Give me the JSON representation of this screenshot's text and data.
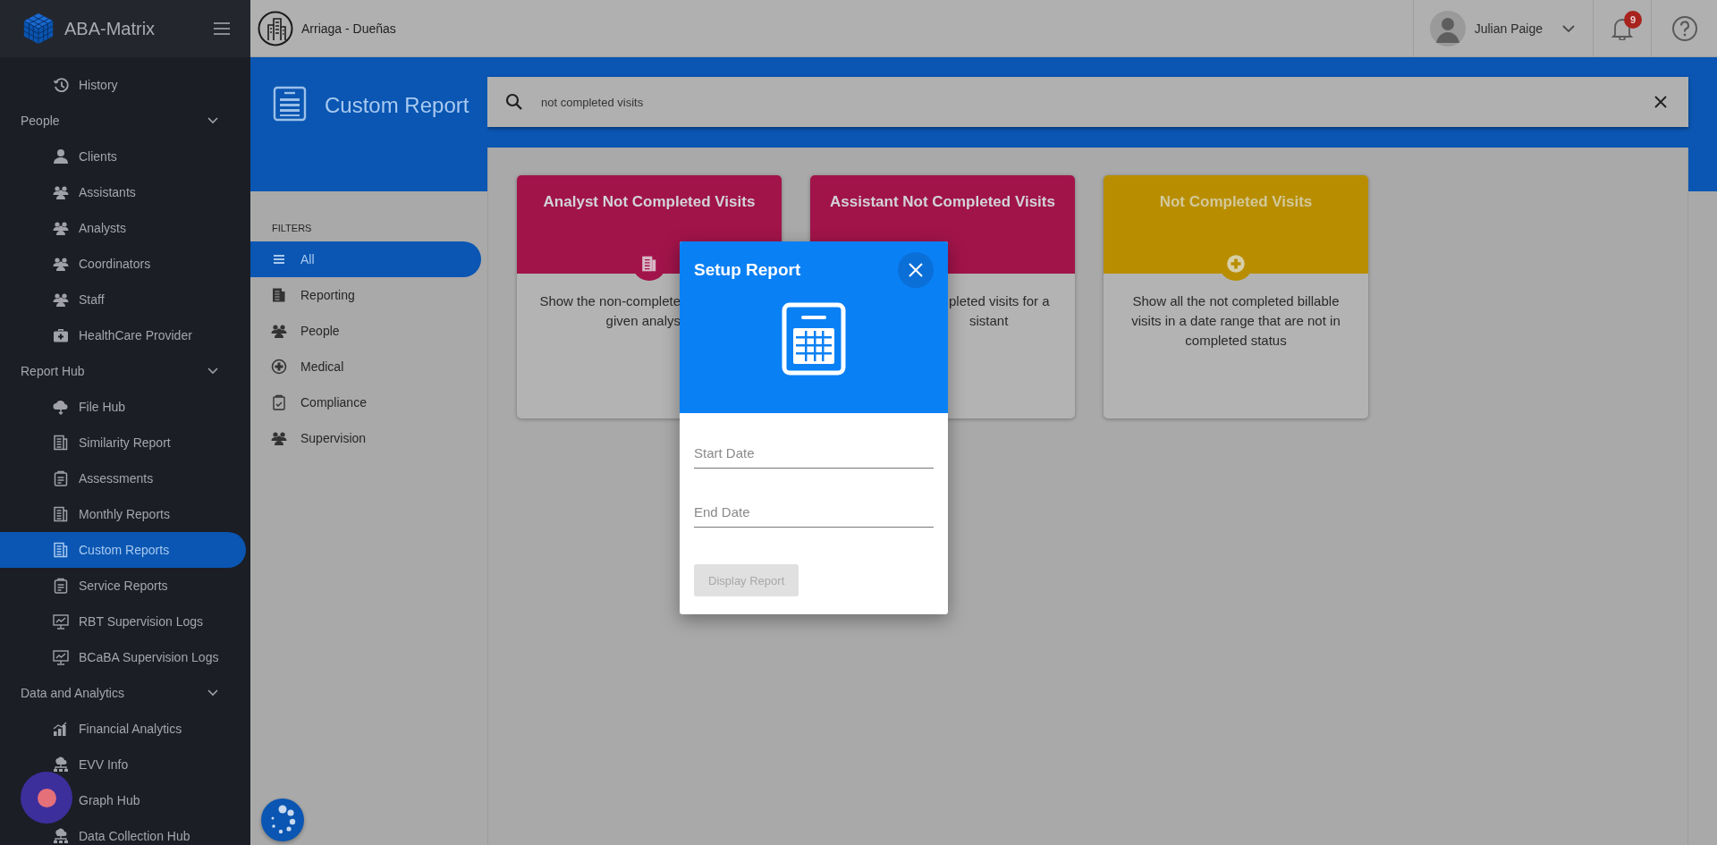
{
  "app": {
    "name": "ABA-Matrix"
  },
  "org": {
    "name": "Arriaga - Dueñas"
  },
  "user": {
    "name": "Julian Paige"
  },
  "notifications": {
    "count": "9"
  },
  "sidebar": {
    "groups": [
      {
        "items": [
          {
            "label": "History",
            "selected": false
          }
        ]
      },
      {
        "title": "People",
        "expanded": true,
        "items": [
          {
            "label": "Clients",
            "selected": false
          },
          {
            "label": "Assistants",
            "selected": false
          },
          {
            "label": "Analysts",
            "selected": false
          },
          {
            "label": "Coordinators",
            "selected": false
          },
          {
            "label": "Staff",
            "selected": false
          },
          {
            "label": "HealthCare Provider",
            "selected": false
          }
        ]
      },
      {
        "title": "Report Hub",
        "expanded": true,
        "items": [
          {
            "label": "File Hub",
            "selected": false
          },
          {
            "label": "Similarity Report",
            "selected": false
          },
          {
            "label": "Assessments",
            "selected": false
          },
          {
            "label": "Monthly Reports",
            "selected": false
          },
          {
            "label": "Custom Reports",
            "selected": true
          },
          {
            "label": "Service Reports",
            "selected": false
          },
          {
            "label": "RBT Supervision Logs",
            "selected": false
          },
          {
            "label": "BCaBA Supervision Logs",
            "selected": false
          }
        ]
      },
      {
        "title": "Data and Analytics",
        "expanded": true,
        "items": [
          {
            "label": "Financial Analytics",
            "selected": false
          },
          {
            "label": "EVV Info",
            "selected": false
          },
          {
            "label": "Graph Hub",
            "selected": false
          },
          {
            "label": "Data Collection Hub",
            "selected": false
          }
        ]
      }
    ]
  },
  "page": {
    "title": "Custom Report"
  },
  "search": {
    "value": "not completed visits"
  },
  "filters": {
    "heading": "FILTERS",
    "items": [
      {
        "label": "All",
        "selected": true
      },
      {
        "label": "Reporting",
        "selected": false
      },
      {
        "label": "People",
        "selected": false
      },
      {
        "label": "Medical",
        "selected": false
      },
      {
        "label": "Compliance",
        "selected": false
      },
      {
        "label": "Supervision",
        "selected": false
      }
    ]
  },
  "cards": [
    {
      "title": "Analyst Not Completed Visits",
      "color": "#a1144a",
      "kind": "reporting",
      "lines": [
        "Show the non-complete",
        "given analys"
      ]
    },
    {
      "title": "Assistant Not Completed Visits",
      "color": "#a1144a",
      "lines": [
        "pleted visits for a",
        "sistant"
      ]
    },
    {
      "title": "Not Completed Visits",
      "color": "#b88e00",
      "kind": "medical",
      "lines": [
        "Show all the not completed billable visits in a date range that are not in completed status"
      ]
    }
  ],
  "dialog": {
    "title": "Setup Report",
    "fields": [
      {
        "placeholder": "Start Date"
      },
      {
        "placeholder": "End Date"
      }
    ],
    "button": {
      "label": "Display Report",
      "disabled": true
    }
  }
}
